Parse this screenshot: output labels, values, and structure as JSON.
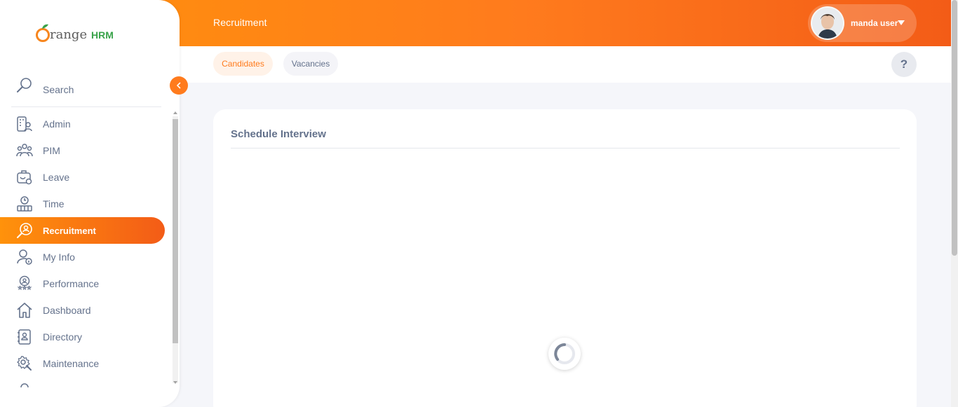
{
  "header": {
    "title": "Recruitment",
    "user_name": "manda user"
  },
  "tabs": [
    {
      "label": "Candidates",
      "active": true
    },
    {
      "label": "Vacancies",
      "active": false
    }
  ],
  "help": {
    "label": "?"
  },
  "card": {
    "title": "Schedule Interview"
  },
  "brand": {
    "text_orange": "range",
    "text_green": "HRM",
    "initial": "O"
  },
  "sidebar": {
    "search_label": "Search",
    "items": [
      {
        "label": "Admin",
        "icon": "admin-icon"
      },
      {
        "label": "PIM",
        "icon": "pim-icon"
      },
      {
        "label": "Leave",
        "icon": "leave-icon"
      },
      {
        "label": "Time",
        "icon": "time-icon"
      },
      {
        "label": "Recruitment",
        "icon": "recruitment-icon",
        "active": true
      },
      {
        "label": "My Info",
        "icon": "my-info-icon"
      },
      {
        "label": "Performance",
        "icon": "performance-icon"
      },
      {
        "label": "Dashboard",
        "icon": "dashboard-icon"
      },
      {
        "label": "Directory",
        "icon": "directory-icon"
      },
      {
        "label": "Maintenance",
        "icon": "maintenance-icon"
      }
    ]
  },
  "colors": {
    "accent": "#ff7b1d",
    "brand_green": "#3aa34b",
    "text_muted": "#64728c"
  }
}
